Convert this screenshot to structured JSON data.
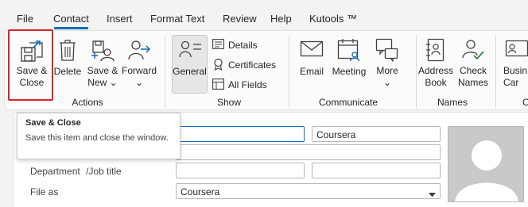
{
  "menu": {
    "items": [
      "File",
      "Contact",
      "Insert",
      "Format Text",
      "Review",
      "Help",
      "Kutools ™"
    ],
    "active": "Contact"
  },
  "ribbon": {
    "actions": {
      "save_close": "Save &\nClose",
      "delete": "Delete",
      "save_new": "Save &\nNew ⌄",
      "forward": "Forward\n⌄",
      "group": "Actions"
    },
    "show": {
      "general": "General",
      "details": "Details",
      "certificates": "Certificates",
      "all_fields": "All Fields",
      "group": "Show"
    },
    "communicate": {
      "email": "Email",
      "meeting": "Meeting",
      "more": "More\n⌄",
      "group": "Communicate"
    },
    "names": {
      "address_book": "Address\nBook",
      "check_names": "Check\nNames",
      "group": "Names"
    },
    "options": {
      "business_card": "Busin\nCar",
      "group": "O"
    }
  },
  "tooltip": {
    "title": "Save & Close",
    "body": "Save this item and close the window."
  },
  "form": {
    "company_value": "Coursera",
    "department_label": "Department",
    "job_title_label": "/Job title",
    "file_as_label": "File as",
    "file_as_value": "Coursera"
  },
  "colors": {
    "accent": "#0f6cbd",
    "highlight_border": "#d6262b"
  }
}
